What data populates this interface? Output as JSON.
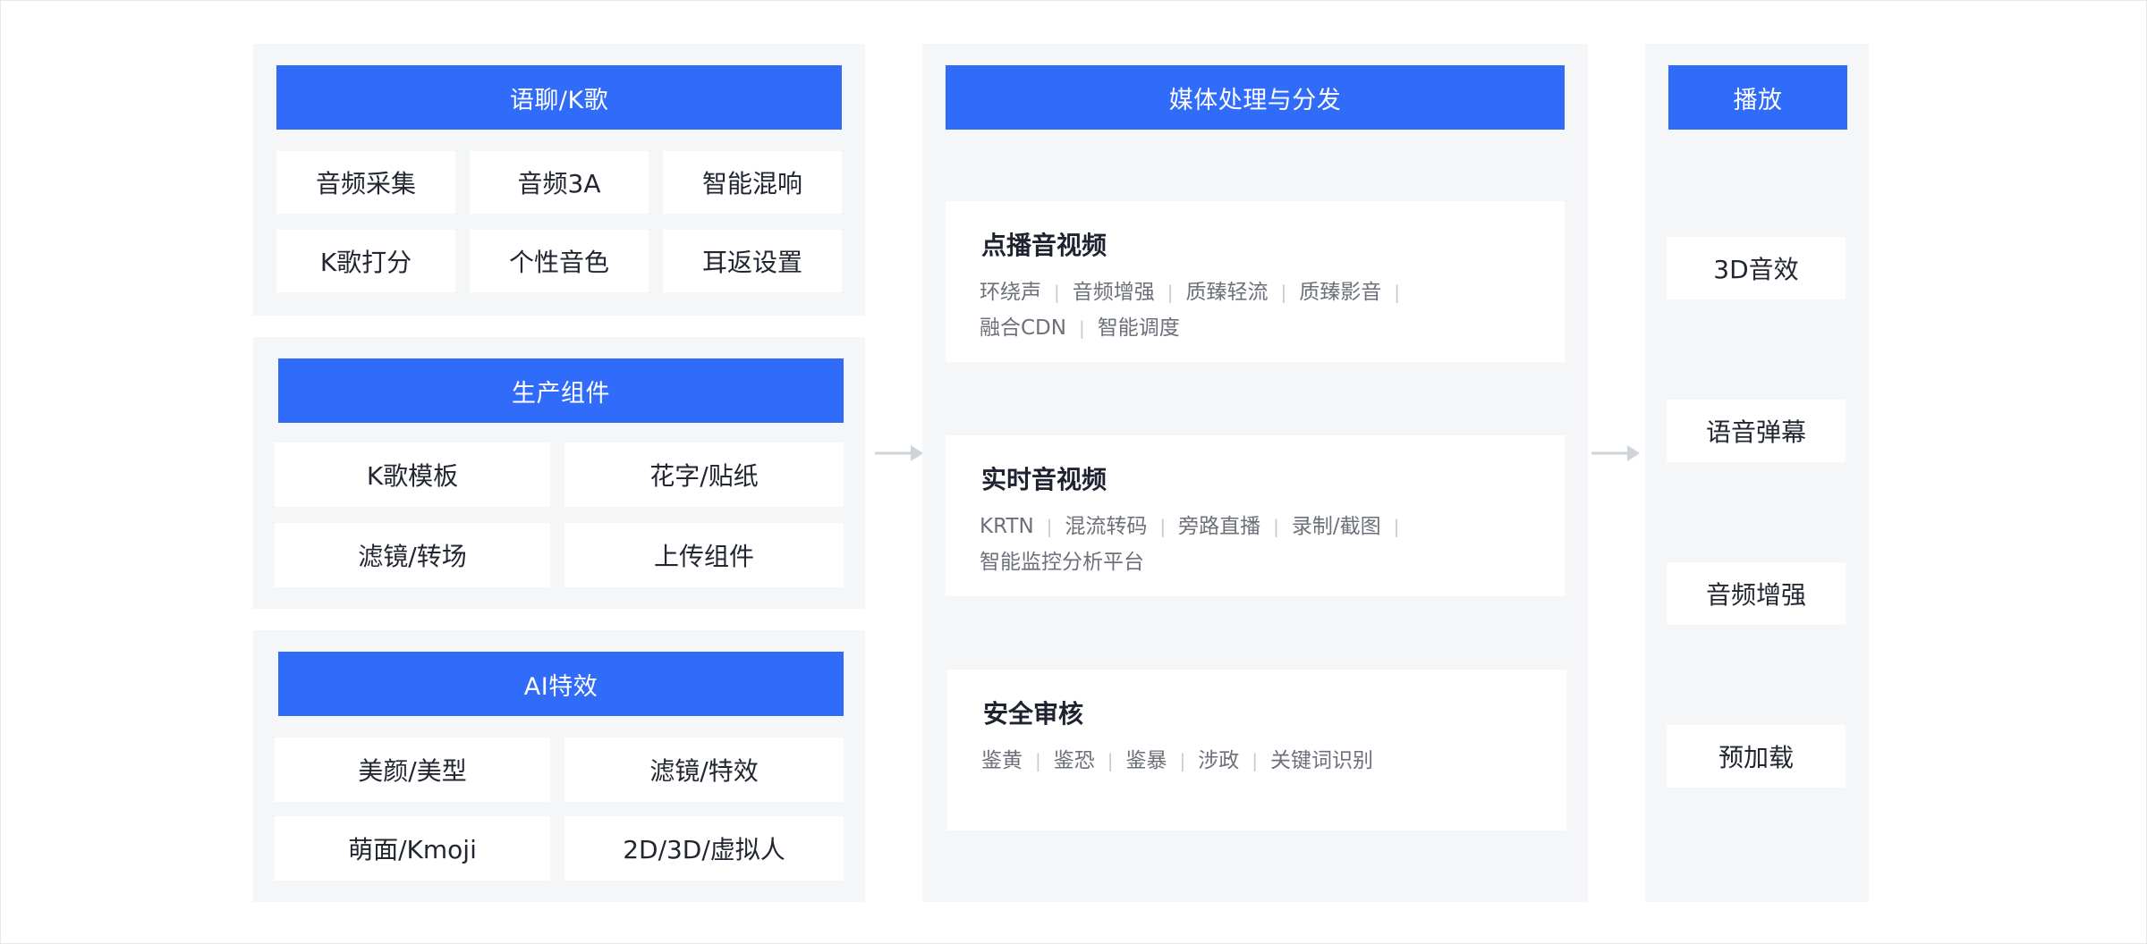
{
  "left": {
    "voice": {
      "title": "语聊/K歌",
      "items": [
        "音频采集",
        "音频3A",
        "智能混响",
        "K歌打分",
        "个性音色",
        "耳返设置"
      ]
    },
    "production": {
      "title": "生产组件",
      "items": [
        "K歌模板",
        "花字/贴纸",
        "滤镜/转场",
        "上传组件"
      ]
    },
    "ai": {
      "title": "AI特效",
      "items": [
        "美颜/美型",
        "滤镜/特效",
        "萌面/Kmoji",
        "2D/3D/虚拟人"
      ]
    }
  },
  "middle": {
    "title": "媒体处理与分发",
    "cards": [
      {
        "title": "点播音视频",
        "tags": [
          "环绕声",
          "音频增强",
          "质臻轻流",
          "质臻影音",
          "融合CDN",
          "智能调度"
        ]
      },
      {
        "title": "实时音视频",
        "tags": [
          "KRTN",
          "混流转码",
          "旁路直播",
          "录制/截图",
          "智能监控分析平台"
        ]
      },
      {
        "title": "安全审核",
        "tags": [
          "鉴黄",
          "鉴恐",
          "鉴暴",
          "涉政",
          "关键词识别"
        ]
      }
    ]
  },
  "right": {
    "title": "播放",
    "items": [
      "3D音效",
      "语音弹幕",
      "音频增强",
      "预加载"
    ]
  },
  "colors": {
    "accent": "#316bf9",
    "panel": "#f5f6f8",
    "arrow": "#cfd3da"
  }
}
